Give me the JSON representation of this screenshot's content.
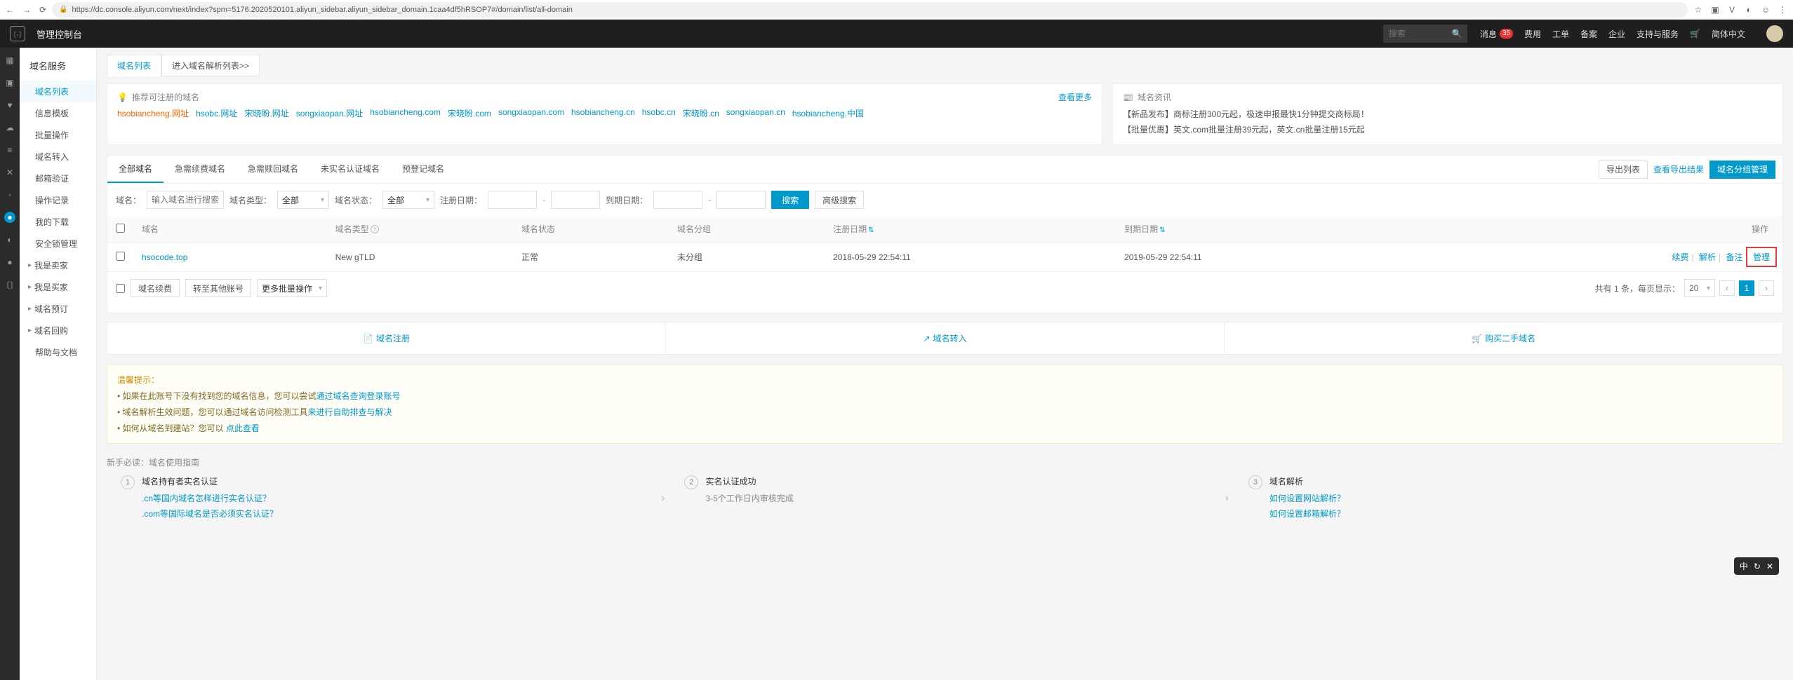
{
  "chrome": {
    "url": "https://dc.console.aliyun.com/next/index?spm=5176.2020520101.aliyun_sidebar.aliyun_sidebar_domain.1caa4df5hRSOP7#/domain/list/all-domain"
  },
  "top": {
    "console_title": "管理控制台",
    "search_placeholder": "搜索",
    "nav": {
      "message": "消息",
      "message_badge": "35",
      "fees": "费用",
      "workorder": "工单",
      "beian": "备案",
      "enterprise": "企业",
      "support": "支持与服务",
      "lang": "简体中文"
    }
  },
  "sidebar": {
    "heading": "域名服务",
    "items": [
      {
        "label": "域名列表",
        "selected": true
      },
      {
        "label": "信息模板"
      },
      {
        "label": "批量操作"
      },
      {
        "label": "域名转入"
      },
      {
        "label": "邮箱验证"
      },
      {
        "label": "操作记录"
      },
      {
        "label": "我的下载"
      },
      {
        "label": "安全锁管理"
      },
      {
        "label": "我是卖家",
        "caret": true
      },
      {
        "label": "我是买家",
        "caret": true
      },
      {
        "label": "域名预订",
        "caret": true
      },
      {
        "label": "域名回购",
        "caret": true
      },
      {
        "label": "帮助与文档"
      }
    ]
  },
  "page_tabs": {
    "list": "域名列表",
    "goto_dns": "进入域名解析列表>>"
  },
  "reco_panel": {
    "title": "推荐可注册的域名",
    "more": "查看更多",
    "links": [
      "hsobiancheng.网址",
      "hsobc.网址",
      "宋晓盼.网址",
      "songxiaopan.网址",
      "hsobiancheng.com",
      "宋晓盼.com",
      "songxiaopan.com",
      "hsobiancheng.cn",
      "hsobc.cn",
      "宋晓盼.cn",
      "songxiaopan.cn",
      "hsobiancheng.中国"
    ]
  },
  "news_panel": {
    "title": "域名资讯",
    "lines": [
      "【新品发布】商标注册300元起，极速申报最快1分钟提交商标局！",
      "【批量优惠】英文.com批量注册39元起，英文.cn批量注册15元起"
    ]
  },
  "tabset": {
    "all": "全部域名",
    "renew": "急需续费域名",
    "redeem": "急需赎回域名",
    "unverified": "未实名认证域名",
    "prereg": "预登记域名",
    "export_list": "导出列表",
    "export_result": "查看导出结果",
    "group_manage": "域名分组管理"
  },
  "filters": {
    "domain_label": "域名：",
    "domain_placeholder": "输入域名进行搜索",
    "type_label": "域名类型：",
    "type_value": "全部",
    "status_label": "域名状态：",
    "status_value": "全部",
    "regdate_label": "注册日期：",
    "expdate_label": "到期日期：",
    "search_btn": "搜索",
    "advanced_btn": "高级搜索"
  },
  "table": {
    "cols": {
      "domain": "域名",
      "type": "域名类型",
      "status": "域名状态",
      "group": "域名分组",
      "regdate": "注册日期",
      "expdate": "到期日期",
      "ops": "操作"
    },
    "rows": [
      {
        "domain": "hsocode.top",
        "type": "New gTLD",
        "status": "正常",
        "group": "未分组",
        "regdate": "2018-05-29 22:54:11",
        "expdate": "2019-05-29 22:54:11"
      }
    ],
    "ops": {
      "renew": "续费",
      "resolve": "解析",
      "remark": "备注",
      "manage": "管理"
    }
  },
  "below": {
    "renew_btn": "域名续费",
    "transfer_btn": "转至其他账号",
    "bulk_label": "更多批量操作",
    "total_text": "共有 1 条，每页显示：",
    "page_size": "20"
  },
  "tri": {
    "register": "域名注册",
    "transfer_in": "域名转入",
    "buy_second": "购买二手域名"
  },
  "warm": {
    "title": "温馨提示：",
    "l1a": "• 如果在此账号下没有找到您的域名信息，您可以尝试",
    "l1b": "通过域名查询登录账号",
    "l2a": "• 域名解析生效问题，您可以通过域名访问检测工具",
    "l2b": "来进行自助排查与解决",
    "l3a": "• 如何从域名到建站？您可以 ",
    "l3b": "点此查看"
  },
  "guide": {
    "hd": "新手必读：域名使用指南",
    "s1": {
      "title": "域名持有者实名认证",
      "a": ".cn等国内域名怎样进行实名认证？",
      "b": ".com等国际域名是否必须实名认证？"
    },
    "s2": {
      "title": "实名认证成功",
      "a": "3-5个工作日内审核完成"
    },
    "s3": {
      "title": "域名解析",
      "a": "如何设置网站解析？",
      "b": "如何设置邮箱解析？"
    }
  }
}
